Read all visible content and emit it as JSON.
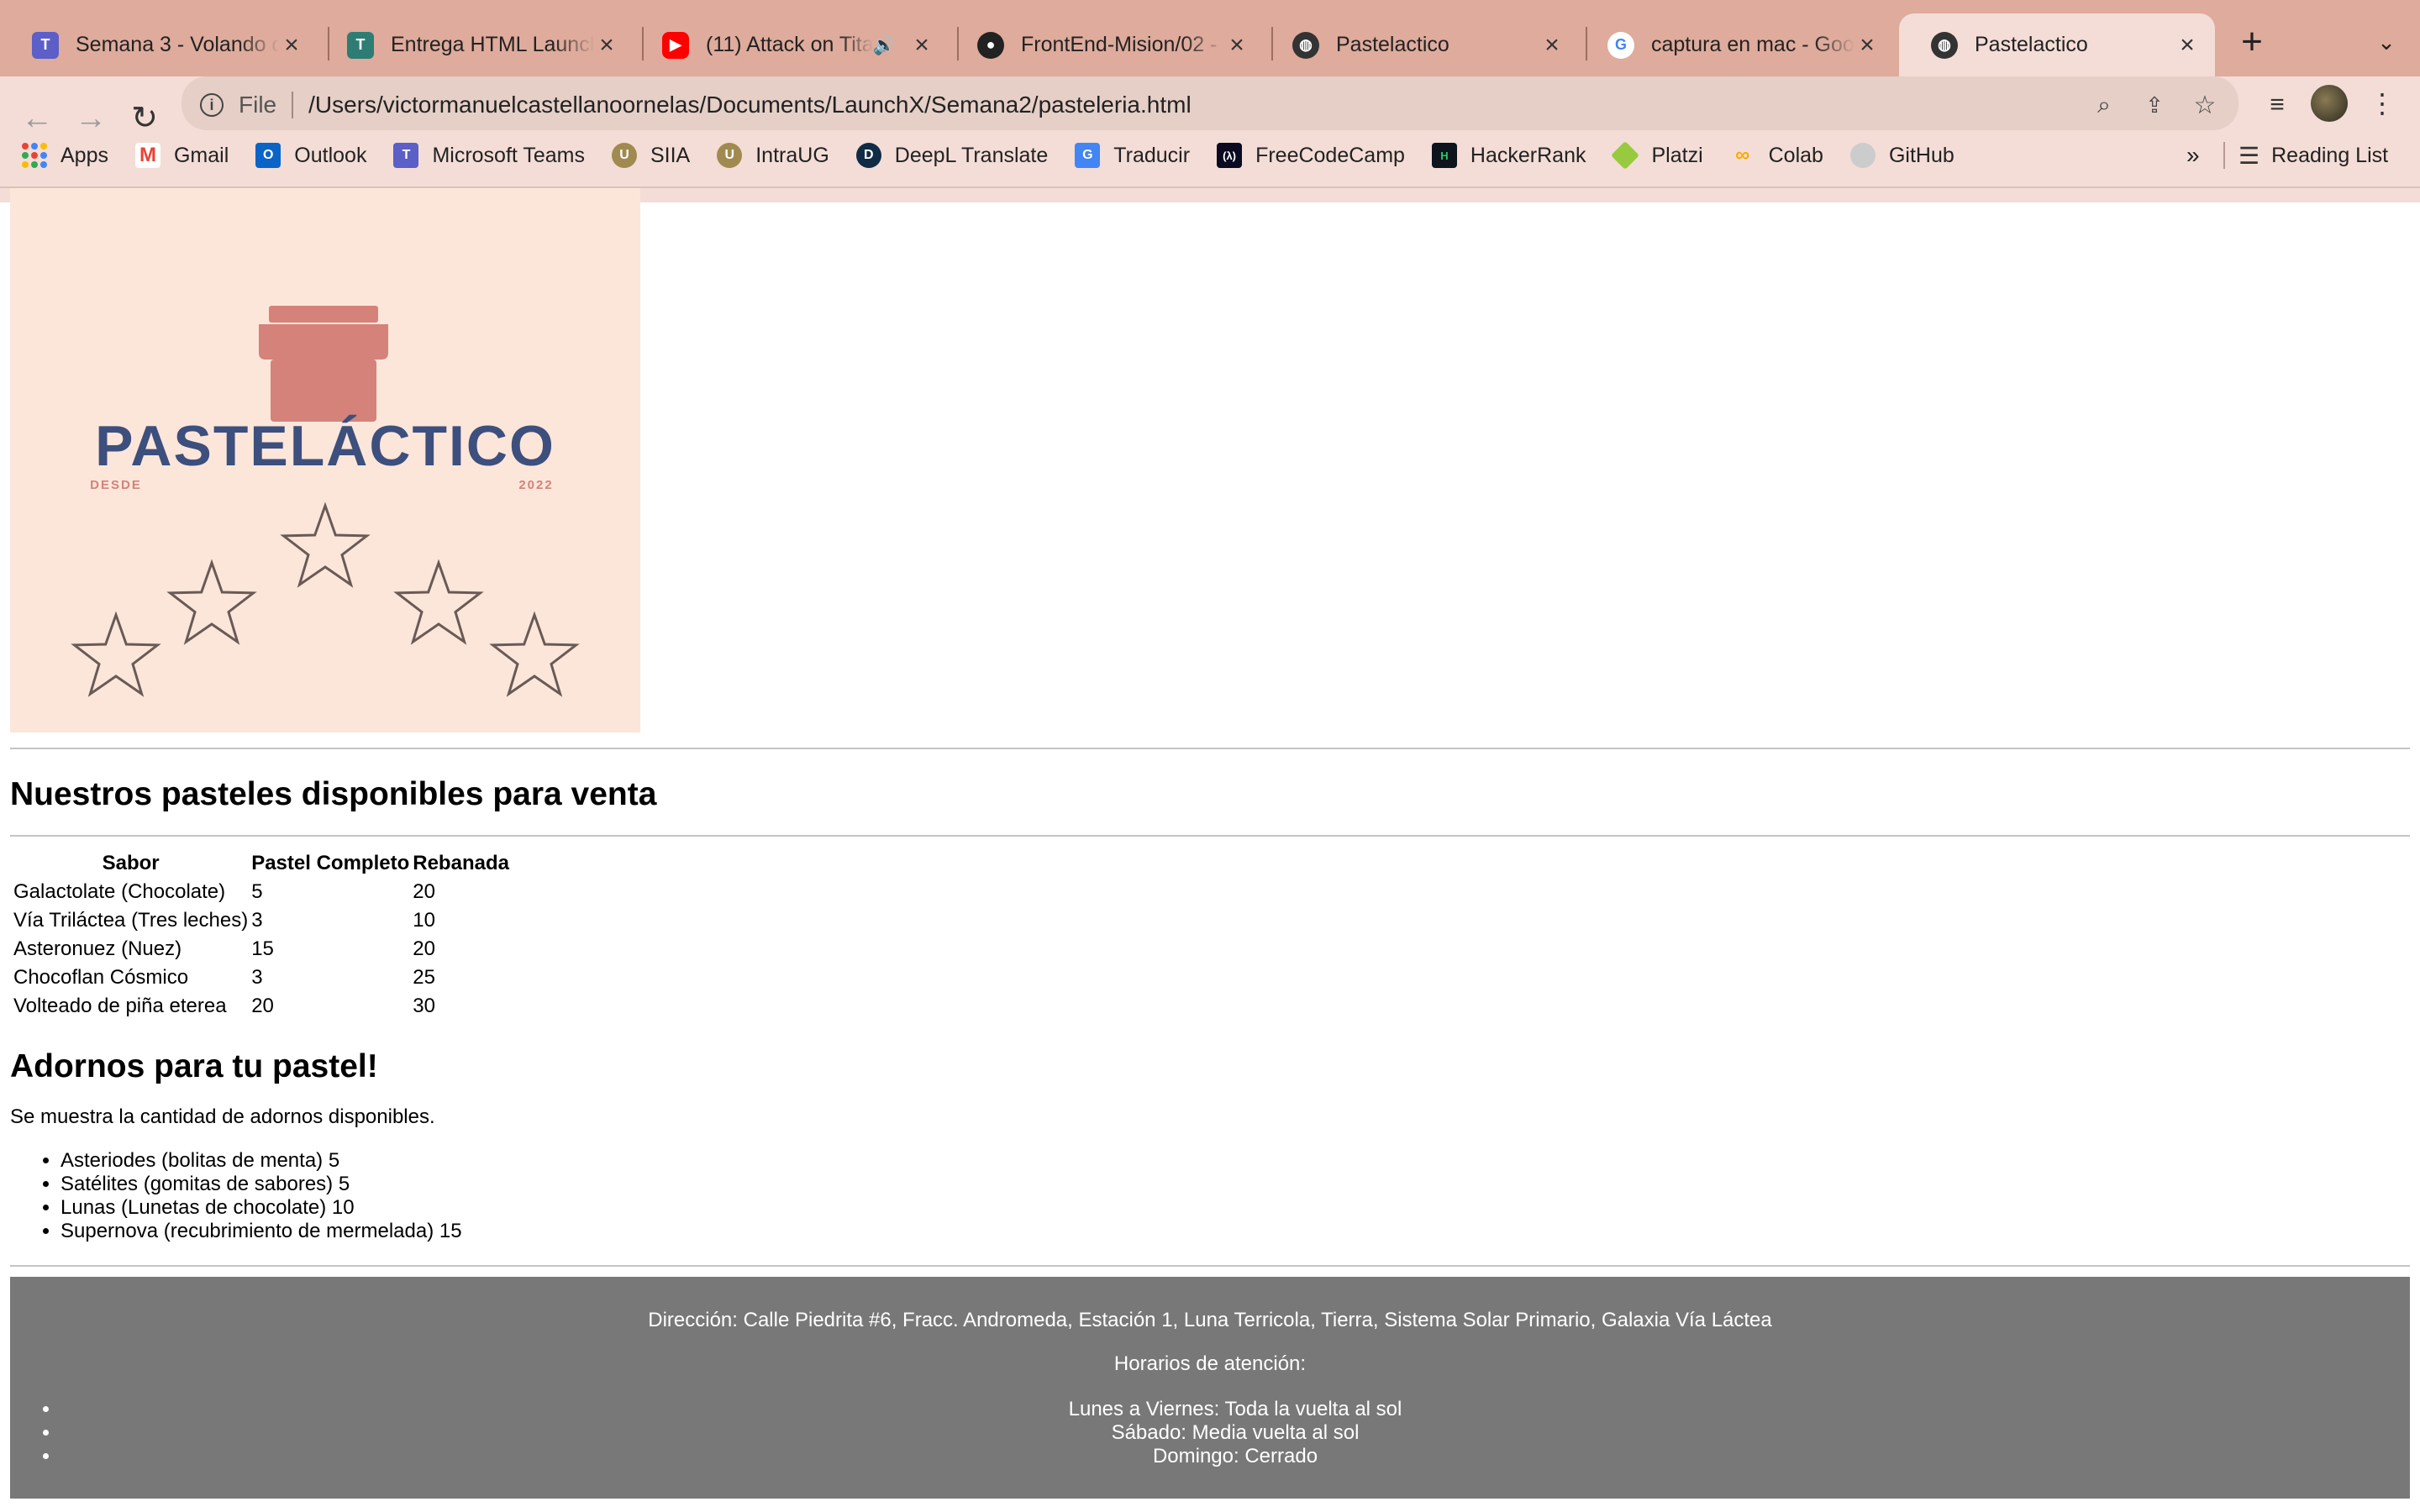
{
  "browser": {
    "tabs": [
      {
        "title": "Semana 3 - Volando d",
        "icon": "teams-icon",
        "color": "#5b5fc7"
      },
      {
        "title": "Entrega HTML Launch",
        "icon": "teams-icon",
        "color": "#2e7d74"
      },
      {
        "title": "(11) Attack on Tita",
        "icon": "youtube-icon",
        "color": "#ff0000",
        "audio": true
      },
      {
        "title": "FrontEnd-Mision/02 -",
        "icon": "github-icon",
        "color": "#222222"
      },
      {
        "title": "Pastelactico",
        "icon": "globe-icon",
        "color": "#333333"
      },
      {
        "title": "captura en mac - Goo",
        "icon": "google-icon",
        "color": "#4285f4"
      },
      {
        "title": "Pastelactico",
        "icon": "globe-icon",
        "color": "#333333",
        "active": true
      }
    ],
    "omnibox": {
      "scheme_label": "File",
      "url": "/Users/victormanuelcastellanoornelas/Documents/LaunchX/Semana2/pasteleria.html"
    },
    "bookmarks": [
      {
        "label": "Apps",
        "icon": "apps-grid-icon",
        "color": "#4285f4"
      },
      {
        "label": "Gmail",
        "icon": "gmail-icon",
        "color": "#ea4335"
      },
      {
        "label": "Outlook",
        "icon": "outlook-icon",
        "color": "#0a64c8"
      },
      {
        "label": "Microsoft Teams",
        "icon": "teams-icon",
        "color": "#5b5fc7"
      },
      {
        "label": "SIIA",
        "icon": "ug-seal-icon",
        "color": "#a08a50"
      },
      {
        "label": "IntraUG",
        "icon": "ug-seal-icon",
        "color": "#a08a50"
      },
      {
        "label": "DeepL Translate",
        "icon": "deepl-icon",
        "color": "#0f2b46"
      },
      {
        "label": "Traducir",
        "icon": "translate-icon",
        "color": "#4285f4"
      },
      {
        "label": "FreeCodeCamp",
        "icon": "freecodecamp-icon",
        "color": "#0a0a23"
      },
      {
        "label": "HackerRank",
        "icon": "hackerrank-icon",
        "color": "#0e141e"
      },
      {
        "label": "Platzi",
        "icon": "platzi-icon",
        "color": "#98ca3f"
      },
      {
        "label": "Colab",
        "icon": "colab-icon",
        "color": "#f9ab00"
      },
      {
        "label": "GitHub",
        "icon": "github-icon",
        "color": "#cccccc"
      }
    ],
    "more_bookmarks": "»",
    "reading_list": "Reading List"
  },
  "logo": {
    "brand": "PASTELÁCTICO",
    "since_label": "DESDE",
    "since_year": "2022",
    "stars": 5
  },
  "cakes": {
    "heading": "Nuestros pasteles disponibles para venta",
    "columns": [
      "Sabor",
      "Pastel Completo",
      "Rebanada"
    ],
    "rows": [
      [
        "Galactolate (Chocolate)",
        "5",
        "20"
      ],
      [
        "Vía Triláctea (Tres leches)",
        "3",
        "10"
      ],
      [
        "Asteronuez (Nuez)",
        "15",
        "20"
      ],
      [
        "Chocoflan Cósmico",
        "3",
        "25"
      ],
      [
        "Volteado de piña eterea",
        "20",
        "30"
      ]
    ]
  },
  "ornaments": {
    "heading": "Adornos para tu pastel!",
    "intro": "Se muestra la cantidad de adornos disponibles.",
    "items": [
      "Asteriodes (bolitas de menta) 5",
      "Satélites (gomitas de sabores) 5",
      "Lunas (Lunetas de chocolate) 10",
      "Supernova (recubrimiento de mermelada) 15"
    ]
  },
  "footer": {
    "address": "Dirección: Calle Piedrita #6, Fracc. Andromeda, Estación 1, Luna Terricola, Tierra, Sistema Solar Primario, Galaxia Vía Láctea",
    "hours_title": "Horarios de atención:",
    "hours": [
      "Lunes a Viernes: Toda la vuelta al sol",
      "Sábado: Media vuelta al sol",
      "Domingo: Cerrado"
    ]
  },
  "colors": {
    "tabbar": "#deab9c",
    "toolbar": "#f3ddd6",
    "logo_bg": "#fce6da",
    "logo_text": "#3d4f7d",
    "logo_accent": "#d4827a",
    "footer_bg": "#787878"
  }
}
